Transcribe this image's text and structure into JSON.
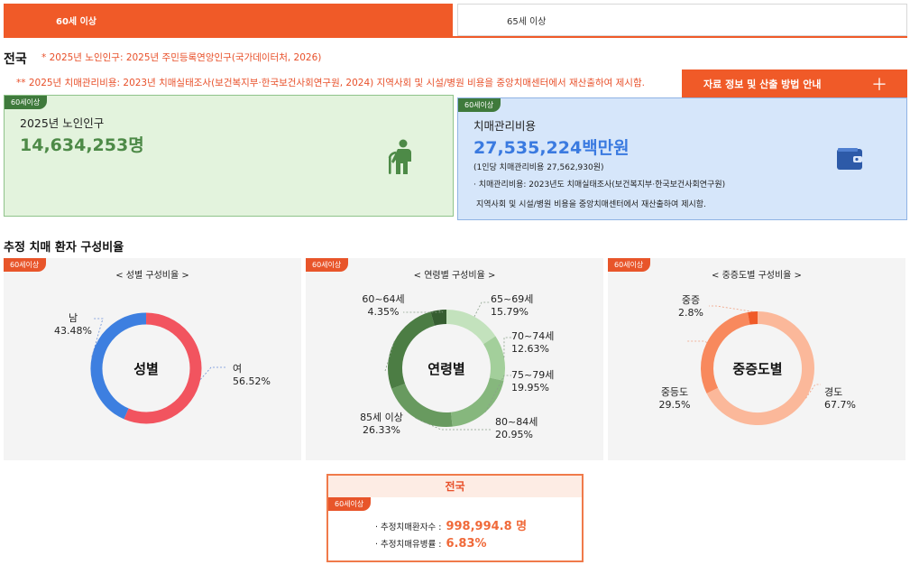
{
  "tabs": {
    "active": "60세 이상",
    "inactive": "65세 이상"
  },
  "region": "전국",
  "notes": {
    "note1": "* 2025년 노인인구: 2025년 주민등록연앙인구(국가데이터처, 2026)",
    "note2": "** 2025년 치매관리비용: 2023년 치매실태조사(보건복지부·한국보건사회연구원, 2024) 지역사회 및 시설/병원 비용을 중앙치매센터에서 재산출하여 제시함."
  },
  "info_button": {
    "label": "자료 정보 및 산출 방법 안내",
    "icon": "plus-icon"
  },
  "badge": "60세이상",
  "elderly_card": {
    "label": "2025년 노인인구",
    "value": "14,634,253명",
    "icon": "elderly-person-icon",
    "color": "#4d8a47"
  },
  "cost_card": {
    "label": "치매관리비용",
    "value": "27,535,224백만원",
    "per_capita": "(1인당 치매관리비용 27,562,930원)",
    "note1": "· 치매관리비용: 2023년도 치매실태조사(보건복지부·한국보건사회연구원)",
    "note2": "지역사회 및 시설/병원 비용을 중앙치매센터에서 재산출하여 제시함.",
    "icon": "wallet-icon",
    "color": "#3a7ae0"
  },
  "section_title": "추정 치매 환자 구성비율",
  "gender_chart": {
    "title": "< 성별 구성비율 >",
    "center": "성별",
    "slices": [
      {
        "label": "남",
        "value": "43.48%",
        "pct": 43.48,
        "color": "#3d7fe0"
      },
      {
        "label": "여",
        "value": "56.52%",
        "pct": 56.52,
        "color": "#f2545f"
      }
    ]
  },
  "age_chart": {
    "title": "< 연령별 구성비율 >",
    "center": "연령별",
    "slices": [
      {
        "label": "65~69세",
        "value": "15.79%",
        "pct": 15.79,
        "color": "#c3e2bd"
      },
      {
        "label": "70~74세",
        "value": "12.63%",
        "pct": 12.63,
        "color": "#a3cf9b"
      },
      {
        "label": "75~79세",
        "value": "19.95%",
        "pct": 19.95,
        "color": "#86b77d"
      },
      {
        "label": "80~84세",
        "value": "20.95%",
        "pct": 20.95,
        "color": "#689a5f"
      },
      {
        "label": "85세 이상",
        "value": "26.33%",
        "pct": 26.33,
        "color": "#4c7d44"
      },
      {
        "label": "60~64세",
        "value": "4.35%",
        "pct": 4.35,
        "color": "#365e31"
      }
    ]
  },
  "severity_chart": {
    "title": "< 중증도별 구성비율 >",
    "center": "중증도별",
    "slices": [
      {
        "label": "경도",
        "value": "67.7%",
        "pct": 67.7,
        "color": "#fbb89a"
      },
      {
        "label": "중등도",
        "value": "29.5%",
        "pct": 29.5,
        "color": "#f8895d"
      },
      {
        "label": "중증",
        "value": "2.8%",
        "pct": 2.8,
        "color": "#f05a28"
      }
    ]
  },
  "summary": {
    "title": "전국",
    "patients_label": "· 추정치매환자수 :",
    "patients_value": "998,994.8 명",
    "prevalence_label": "· 추정치매유병률 :",
    "prevalence_value": "6.83%"
  }
}
